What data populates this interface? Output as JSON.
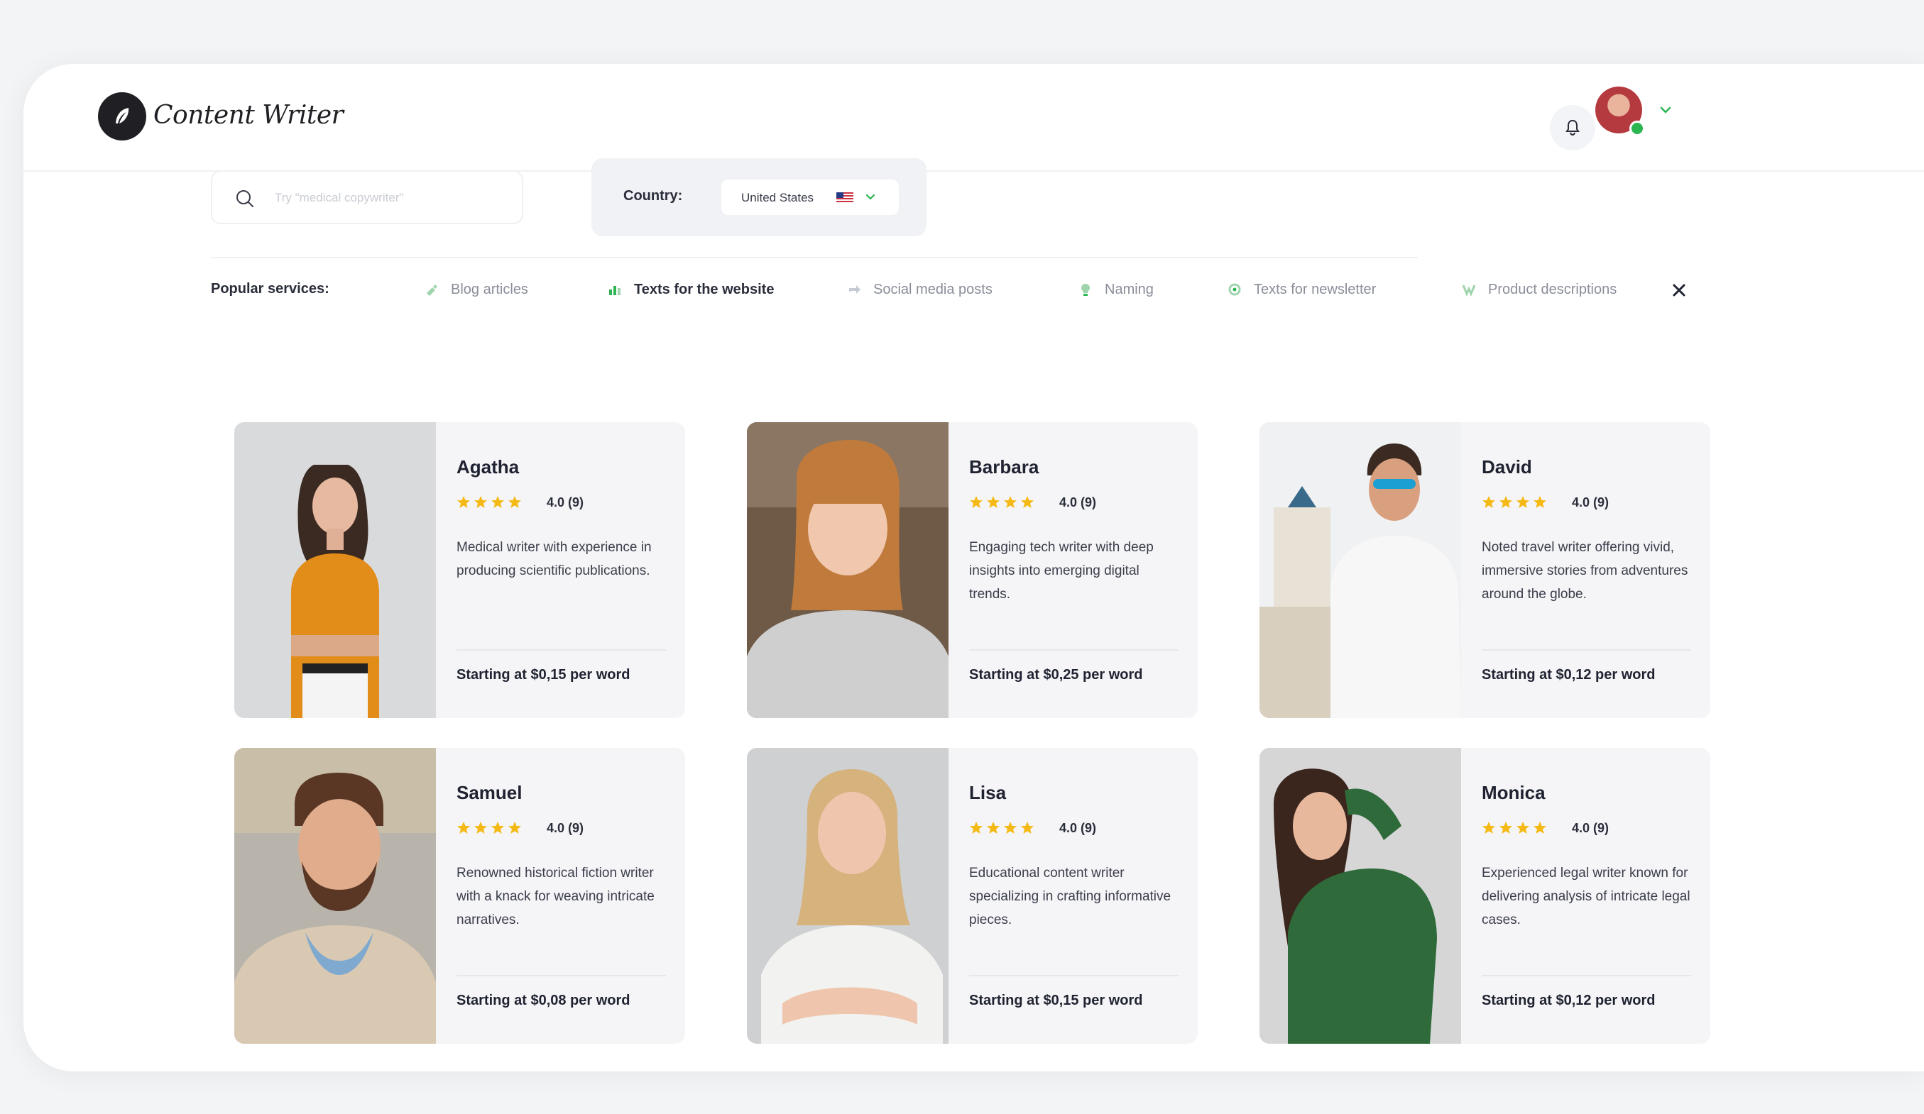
{
  "header": {
    "logo_text": "Content Writer",
    "icons": {
      "logo": "feather-icon",
      "notifications": "bell-icon",
      "menu": "chevron-down-icon"
    }
  },
  "filters": {
    "search_placeholder": "Try \"medical copywriter\"",
    "country_label": "Country:",
    "country_value": "United States",
    "country_flag": "us-flag-icon"
  },
  "services": {
    "label": "Popular services:",
    "items": [
      {
        "label": "Blog articles",
        "icon": "article-icon",
        "active": false
      },
      {
        "label": "Texts for the website",
        "icon": "chart-icon",
        "active": true
      },
      {
        "label": "Social media posts",
        "icon": "share-icon",
        "active": false
      },
      {
        "label": "Naming",
        "icon": "bulb-icon",
        "active": false
      },
      {
        "label": "Texts for newsletter",
        "icon": "mail-icon",
        "active": false
      },
      {
        "label": "Product descriptions",
        "icon": "product-icon",
        "active": false
      }
    ]
  },
  "writers": [
    {
      "name": "Agatha",
      "rating": "4.0 (9)",
      "stars": 4,
      "description": "Medical writer with experience in producing scientific publications.",
      "price": "Starting at $0,15 per word"
    },
    {
      "name": "Barbara",
      "rating": "4.0 (9)",
      "stars": 4,
      "description": "Engaging tech writer with deep insights into emerging digital trends.",
      "price": "Starting at $0,25 per word"
    },
    {
      "name": "David",
      "rating": "4.0 (9)",
      "stars": 4,
      "description": "Noted travel writer offering vivid, immersive stories from adventures around the globe.",
      "price": "Starting at $0,12 per word"
    },
    {
      "name": "Samuel",
      "rating": "4.0 (9)",
      "stars": 4,
      "description": "Renowned historical fiction writer with a knack for weaving intricate narratives.",
      "price": "Starting at $0,08 per word"
    },
    {
      "name": "Lisa",
      "rating": "4.0 (9)",
      "stars": 4,
      "description": "Educational content writer specializing in crafting informative pieces.",
      "price": "Starting at $0,15 per word"
    },
    {
      "name": "Monica",
      "rating": "4.0 (9)",
      "stars": 4,
      "description": "Experienced legal writer known for delivering analysis of intricate legal cases.",
      "price": "Starting at $0,12 per word"
    }
  ],
  "colors": {
    "accent": "#2db552",
    "star": "#f5b915",
    "card_bg": "#f5f5f7"
  }
}
